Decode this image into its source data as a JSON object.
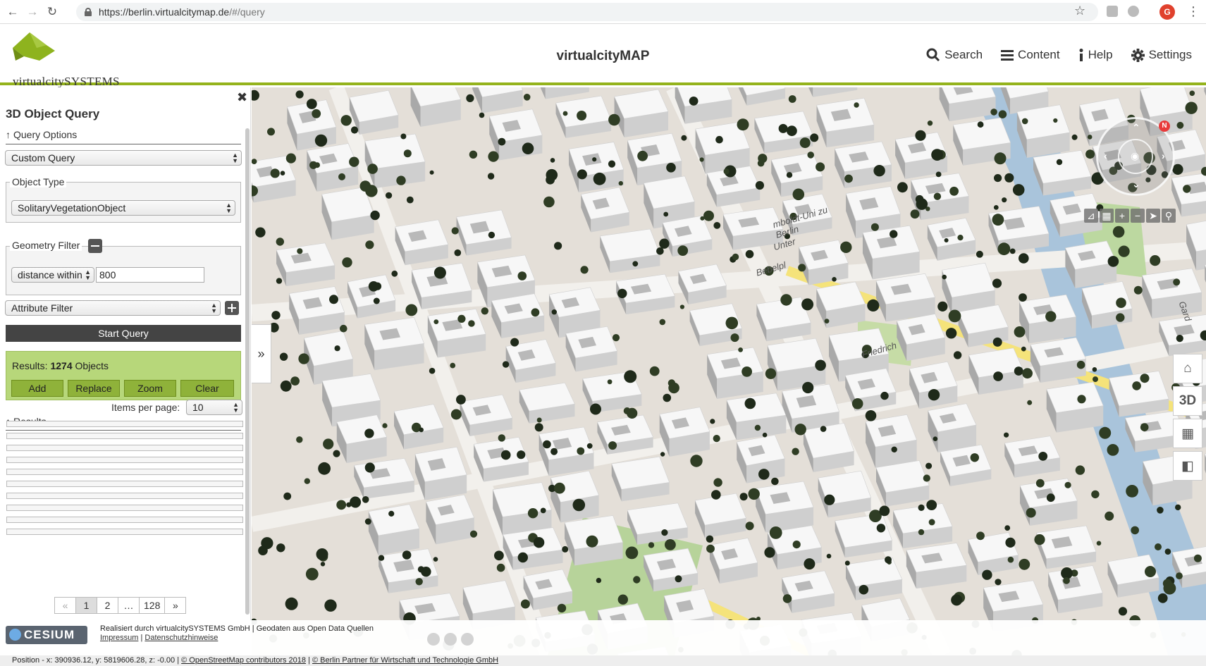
{
  "browser": {
    "url_host": "https://berlin.virtualcitymap.de",
    "url_path": "/#/query",
    "profile_initial": "G"
  },
  "header": {
    "logo_text": "virtualcitySYSTEMS",
    "title": "virtualcityMAP",
    "nav": [
      {
        "label": "Search",
        "icon": "search-icon"
      },
      {
        "label": "Content",
        "icon": "menu-icon"
      },
      {
        "label": "Help",
        "icon": "info-icon"
      },
      {
        "label": "Settings",
        "icon": "gear-icon"
      }
    ]
  },
  "sidebar": {
    "close": "✖",
    "title": "3D Object Query",
    "query_options_label": "Query Options",
    "query_select": "Custom Query",
    "object_type": {
      "legend": "Object Type",
      "value": "SolitaryVegetationObject"
    },
    "geometry_filter": {
      "legend": "Geometry Filter",
      "mode": "distance within",
      "value": "800"
    },
    "attribute_filter": "Attribute Filter",
    "start_button": "Start Query",
    "results_summary": {
      "prefix": "Results:",
      "count": "1274",
      "suffix": "Objects"
    },
    "result_buttons": [
      "Add",
      "Replace",
      "Zoom",
      "Clear"
    ],
    "results_label": "Results",
    "items_per_page_label": "Items per page:",
    "items_per_page": "10",
    "result_row_count": 10,
    "pagination": [
      "«",
      "1",
      "2",
      "…",
      "128",
      "»"
    ],
    "collapse": "»"
  },
  "map": {
    "labels": [
      "Unter",
      "Friedrich",
      "Bebelpl",
      "mboldt-Uni zu Berlin",
      "Gard"
    ],
    "compass_n": "N",
    "side_tools": [
      "home-icon",
      "3D",
      "grid-icon",
      "map-icon"
    ],
    "side_3d_label": "3D"
  },
  "footer": {
    "cesium": "CESIUM",
    "credit_line": "Realisiert durch virtualcitySYSTEMS GmbH | Geodaten aus Open Data Quellen",
    "impressum": "Impressum",
    "sep": "|",
    "datenschutz": "Datenschutzhinweise"
  },
  "status": {
    "position": "Position - x: 390936.12, y: 5819606.28, z: -0.00 |",
    "osm": "© OpenStreetMap contributors 2018",
    "sep": "|",
    "partner": "© Berlin Partner für Wirtschaft und Technologie GmbH"
  },
  "colors": {
    "accent": "#94b31c",
    "results_bg": "#b7d77a",
    "button_dark": "#444444"
  }
}
